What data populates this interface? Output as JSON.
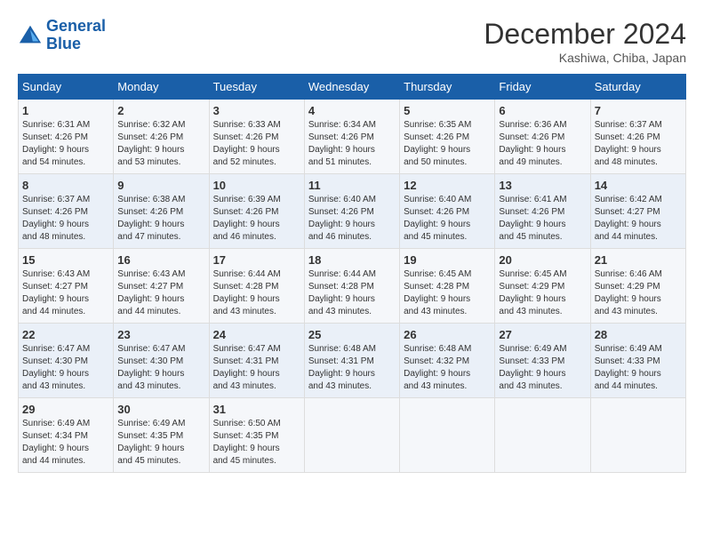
{
  "header": {
    "logo_line1": "General",
    "logo_line2": "Blue",
    "month": "December 2024",
    "location": "Kashiwa, Chiba, Japan"
  },
  "days_of_week": [
    "Sunday",
    "Monday",
    "Tuesday",
    "Wednesday",
    "Thursday",
    "Friday",
    "Saturday"
  ],
  "weeks": [
    [
      {
        "num": "1",
        "info": "Sunrise: 6:31 AM\nSunset: 4:26 PM\nDaylight: 9 hours\nand 54 minutes."
      },
      {
        "num": "2",
        "info": "Sunrise: 6:32 AM\nSunset: 4:26 PM\nDaylight: 9 hours\nand 53 minutes."
      },
      {
        "num": "3",
        "info": "Sunrise: 6:33 AM\nSunset: 4:26 PM\nDaylight: 9 hours\nand 52 minutes."
      },
      {
        "num": "4",
        "info": "Sunrise: 6:34 AM\nSunset: 4:26 PM\nDaylight: 9 hours\nand 51 minutes."
      },
      {
        "num": "5",
        "info": "Sunrise: 6:35 AM\nSunset: 4:26 PM\nDaylight: 9 hours\nand 50 minutes."
      },
      {
        "num": "6",
        "info": "Sunrise: 6:36 AM\nSunset: 4:26 PM\nDaylight: 9 hours\nand 49 minutes."
      },
      {
        "num": "7",
        "info": "Sunrise: 6:37 AM\nSunset: 4:26 PM\nDaylight: 9 hours\nand 48 minutes."
      }
    ],
    [
      {
        "num": "8",
        "info": "Sunrise: 6:37 AM\nSunset: 4:26 PM\nDaylight: 9 hours\nand 48 minutes."
      },
      {
        "num": "9",
        "info": "Sunrise: 6:38 AM\nSunset: 4:26 PM\nDaylight: 9 hours\nand 47 minutes."
      },
      {
        "num": "10",
        "info": "Sunrise: 6:39 AM\nSunset: 4:26 PM\nDaylight: 9 hours\nand 46 minutes."
      },
      {
        "num": "11",
        "info": "Sunrise: 6:40 AM\nSunset: 4:26 PM\nDaylight: 9 hours\nand 46 minutes."
      },
      {
        "num": "12",
        "info": "Sunrise: 6:40 AM\nSunset: 4:26 PM\nDaylight: 9 hours\nand 45 minutes."
      },
      {
        "num": "13",
        "info": "Sunrise: 6:41 AM\nSunset: 4:26 PM\nDaylight: 9 hours\nand 45 minutes."
      },
      {
        "num": "14",
        "info": "Sunrise: 6:42 AM\nSunset: 4:27 PM\nDaylight: 9 hours\nand 44 minutes."
      }
    ],
    [
      {
        "num": "15",
        "info": "Sunrise: 6:43 AM\nSunset: 4:27 PM\nDaylight: 9 hours\nand 44 minutes."
      },
      {
        "num": "16",
        "info": "Sunrise: 6:43 AM\nSunset: 4:27 PM\nDaylight: 9 hours\nand 44 minutes."
      },
      {
        "num": "17",
        "info": "Sunrise: 6:44 AM\nSunset: 4:28 PM\nDaylight: 9 hours\nand 43 minutes."
      },
      {
        "num": "18",
        "info": "Sunrise: 6:44 AM\nSunset: 4:28 PM\nDaylight: 9 hours\nand 43 minutes."
      },
      {
        "num": "19",
        "info": "Sunrise: 6:45 AM\nSunset: 4:28 PM\nDaylight: 9 hours\nand 43 minutes."
      },
      {
        "num": "20",
        "info": "Sunrise: 6:45 AM\nSunset: 4:29 PM\nDaylight: 9 hours\nand 43 minutes."
      },
      {
        "num": "21",
        "info": "Sunrise: 6:46 AM\nSunset: 4:29 PM\nDaylight: 9 hours\nand 43 minutes."
      }
    ],
    [
      {
        "num": "22",
        "info": "Sunrise: 6:47 AM\nSunset: 4:30 PM\nDaylight: 9 hours\nand 43 minutes."
      },
      {
        "num": "23",
        "info": "Sunrise: 6:47 AM\nSunset: 4:30 PM\nDaylight: 9 hours\nand 43 minutes."
      },
      {
        "num": "24",
        "info": "Sunrise: 6:47 AM\nSunset: 4:31 PM\nDaylight: 9 hours\nand 43 minutes."
      },
      {
        "num": "25",
        "info": "Sunrise: 6:48 AM\nSunset: 4:31 PM\nDaylight: 9 hours\nand 43 minutes."
      },
      {
        "num": "26",
        "info": "Sunrise: 6:48 AM\nSunset: 4:32 PM\nDaylight: 9 hours\nand 43 minutes."
      },
      {
        "num": "27",
        "info": "Sunrise: 6:49 AM\nSunset: 4:33 PM\nDaylight: 9 hours\nand 43 minutes."
      },
      {
        "num": "28",
        "info": "Sunrise: 6:49 AM\nSunset: 4:33 PM\nDaylight: 9 hours\nand 44 minutes."
      }
    ],
    [
      {
        "num": "29",
        "info": "Sunrise: 6:49 AM\nSunset: 4:34 PM\nDaylight: 9 hours\nand 44 minutes."
      },
      {
        "num": "30",
        "info": "Sunrise: 6:49 AM\nSunset: 4:35 PM\nDaylight: 9 hours\nand 45 minutes."
      },
      {
        "num": "31",
        "info": "Sunrise: 6:50 AM\nSunset: 4:35 PM\nDaylight: 9 hours\nand 45 minutes."
      },
      {
        "num": "",
        "info": ""
      },
      {
        "num": "",
        "info": ""
      },
      {
        "num": "",
        "info": ""
      },
      {
        "num": "",
        "info": ""
      }
    ]
  ]
}
